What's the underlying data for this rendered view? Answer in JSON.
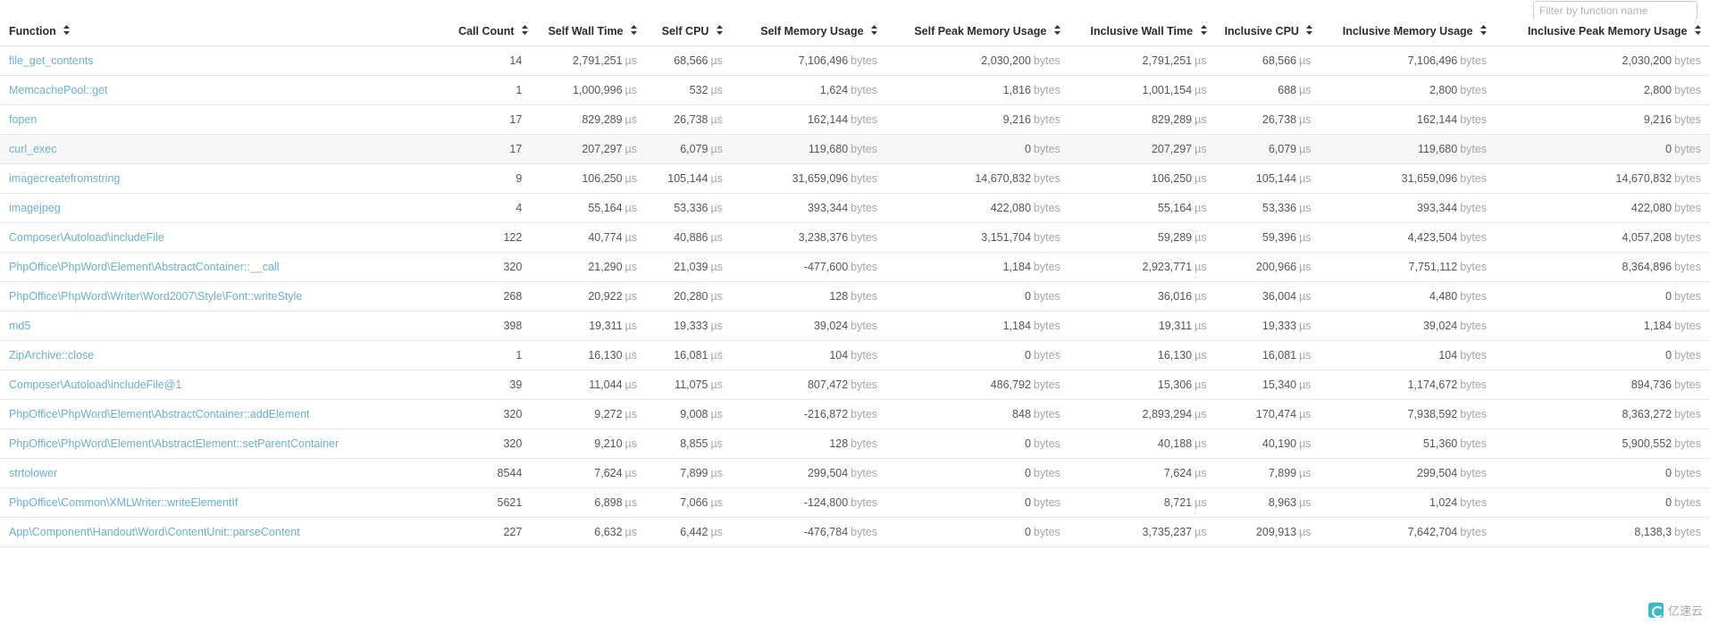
{
  "filter": {
    "placeholder": "Filter by function name",
    "value": ""
  },
  "columns": [
    {
      "label": "Function",
      "align": "left",
      "sort_icon": "sort-updown-icon"
    },
    {
      "label": "Call Count",
      "align": "right",
      "sort_icon": "sort-updown-icon"
    },
    {
      "label": "Self Wall Time",
      "align": "right",
      "sort_icon": "sort-updown-icon"
    },
    {
      "label": "Self CPU",
      "align": "right",
      "sort_icon": "sort-updown-icon"
    },
    {
      "label": "Self Memory Usage",
      "align": "right",
      "sort_icon": "sort-updown-icon"
    },
    {
      "label": "Self Peak Memory Usage",
      "align": "right",
      "sort_icon": "sort-updown-icon"
    },
    {
      "label": "Inclusive Wall Time",
      "align": "right",
      "sort_icon": "sort-updown-icon"
    },
    {
      "label": "Inclusive CPU",
      "align": "right",
      "sort_icon": "sort-updown-icon"
    },
    {
      "label": "Inclusive Memory Usage",
      "align": "right",
      "sort_icon": "sort-updown-icon"
    },
    {
      "label": "Inclusive Peak Memory Usage",
      "align": "right",
      "sort_icon": "sort-updown-icon"
    }
  ],
  "units": {
    "time": "µs",
    "bytes": "bytes"
  },
  "colors": {
    "link": "#6ab0d4",
    "value": "#565656",
    "unit": "#a6a6a6",
    "row_alt_bg": "#f7f7f7",
    "header_text": "#2b2b2b"
  },
  "rows": [
    {
      "function": "file_get_contents",
      "call_count": "14",
      "self_wall_time": "2,791,251",
      "self_cpu": "68,566",
      "self_memory": "7,106,496",
      "self_peak_memory": "2,030,200",
      "incl_wall_time": "2,791,251",
      "incl_cpu": "68,566",
      "incl_memory": "7,106,496",
      "incl_peak_memory": "2,030,200"
    },
    {
      "function": "MemcachePool::get",
      "call_count": "1",
      "self_wall_time": "1,000,996",
      "self_cpu": "532",
      "self_memory": "1,624",
      "self_peak_memory": "1,816",
      "incl_wall_time": "1,001,154",
      "incl_cpu": "688",
      "incl_memory": "2,800",
      "incl_peak_memory": "2,800"
    },
    {
      "function": "fopen",
      "call_count": "17",
      "self_wall_time": "829,289",
      "self_cpu": "26,738",
      "self_memory": "162,144",
      "self_peak_memory": "9,216",
      "incl_wall_time": "829,289",
      "incl_cpu": "26,738",
      "incl_memory": "162,144",
      "incl_peak_memory": "9,216"
    },
    {
      "function": "curl_exec",
      "call_count": "17",
      "self_wall_time": "207,297",
      "self_cpu": "6,079",
      "self_memory": "119,680",
      "self_peak_memory": "0",
      "incl_wall_time": "207,297",
      "incl_cpu": "6,079",
      "incl_memory": "119,680",
      "incl_peak_memory": "0"
    },
    {
      "function": "imagecreatefromstring",
      "call_count": "9",
      "self_wall_time": "106,250",
      "self_cpu": "105,144",
      "self_memory": "31,659,096",
      "self_peak_memory": "14,670,832",
      "incl_wall_time": "106,250",
      "incl_cpu": "105,144",
      "incl_memory": "31,659,096",
      "incl_peak_memory": "14,670,832"
    },
    {
      "function": "imagejpeg",
      "call_count": "4",
      "self_wall_time": "55,164",
      "self_cpu": "53,336",
      "self_memory": "393,344",
      "self_peak_memory": "422,080",
      "incl_wall_time": "55,164",
      "incl_cpu": "53,336",
      "incl_memory": "393,344",
      "incl_peak_memory": "422,080"
    },
    {
      "function": "Composer\\Autoload\\includeFile",
      "call_count": "122",
      "self_wall_time": "40,774",
      "self_cpu": "40,886",
      "self_memory": "3,238,376",
      "self_peak_memory": "3,151,704",
      "incl_wall_time": "59,289",
      "incl_cpu": "59,396",
      "incl_memory": "4,423,504",
      "incl_peak_memory": "4,057,208"
    },
    {
      "function": "PhpOffice\\PhpWord\\Element\\AbstractContainer::__call",
      "call_count": "320",
      "self_wall_time": "21,290",
      "self_cpu": "21,039",
      "self_memory": "-477,600",
      "self_peak_memory": "1,184",
      "incl_wall_time": "2,923,771",
      "incl_cpu": "200,966",
      "incl_memory": "7,751,112",
      "incl_peak_memory": "8,364,896"
    },
    {
      "function": "PhpOffice\\PhpWord\\Writer\\Word2007\\Style\\Font::writeStyle",
      "call_count": "268",
      "self_wall_time": "20,922",
      "self_cpu": "20,280",
      "self_memory": "128",
      "self_peak_memory": "0",
      "incl_wall_time": "36,016",
      "incl_cpu": "36,004",
      "incl_memory": "4,480",
      "incl_peak_memory": "0"
    },
    {
      "function": "md5",
      "call_count": "398",
      "self_wall_time": "19,311",
      "self_cpu": "19,333",
      "self_memory": "39,024",
      "self_peak_memory": "1,184",
      "incl_wall_time": "19,311",
      "incl_cpu": "19,333",
      "incl_memory": "39,024",
      "incl_peak_memory": "1,184"
    },
    {
      "function": "ZipArchive::close",
      "call_count": "1",
      "self_wall_time": "16,130",
      "self_cpu": "16,081",
      "self_memory": "104",
      "self_peak_memory": "0",
      "incl_wall_time": "16,130",
      "incl_cpu": "16,081",
      "incl_memory": "104",
      "incl_peak_memory": "0"
    },
    {
      "function": "Composer\\Autoload\\includeFile@1",
      "call_count": "39",
      "self_wall_time": "11,044",
      "self_cpu": "11,075",
      "self_memory": "807,472",
      "self_peak_memory": "486,792",
      "incl_wall_time": "15,306",
      "incl_cpu": "15,340",
      "incl_memory": "1,174,672",
      "incl_peak_memory": "894,736"
    },
    {
      "function": "PhpOffice\\PhpWord\\Element\\AbstractContainer::addElement",
      "call_count": "320",
      "self_wall_time": "9,272",
      "self_cpu": "9,008",
      "self_memory": "-216,872",
      "self_peak_memory": "848",
      "incl_wall_time": "2,893,294",
      "incl_cpu": "170,474",
      "incl_memory": "7,938,592",
      "incl_peak_memory": "8,363,272"
    },
    {
      "function": "PhpOffice\\PhpWord\\Element\\AbstractElement::setParentContainer",
      "call_count": "320",
      "self_wall_time": "9,210",
      "self_cpu": "8,855",
      "self_memory": "128",
      "self_peak_memory": "0",
      "incl_wall_time": "40,188",
      "incl_cpu": "40,190",
      "incl_memory": "51,360",
      "incl_peak_memory": "5,900,552"
    },
    {
      "function": "strtolower",
      "call_count": "8544",
      "self_wall_time": "7,624",
      "self_cpu": "7,899",
      "self_memory": "299,504",
      "self_peak_memory": "0",
      "incl_wall_time": "7,624",
      "incl_cpu": "7,899",
      "incl_memory": "299,504",
      "incl_peak_memory": "0"
    },
    {
      "function": "PhpOffice\\Common\\XMLWriter::writeElementIf",
      "call_count": "5621",
      "self_wall_time": "6,898",
      "self_cpu": "7,066",
      "self_memory": "-124,800",
      "self_peak_memory": "0",
      "incl_wall_time": "8,721",
      "incl_cpu": "8,963",
      "incl_memory": "1,024",
      "incl_peak_memory": "0"
    },
    {
      "function": "App\\Component\\Handout\\Word\\ContentUnit::parseContent",
      "call_count": "227",
      "self_wall_time": "6,632",
      "self_cpu": "6,442",
      "self_memory": "-476,784",
      "self_peak_memory": "0",
      "incl_wall_time": "3,735,237",
      "incl_cpu": "209,913",
      "incl_memory": "7,642,704",
      "incl_peak_memory": "8,138,3"
    }
  ],
  "watermark": {
    "text": "亿速云"
  }
}
